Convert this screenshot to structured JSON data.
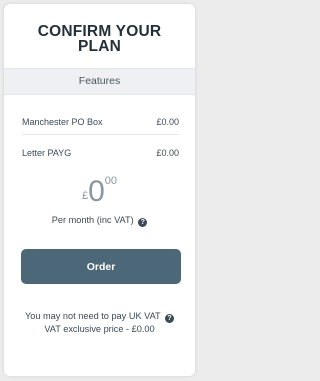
{
  "title": {
    "line1": "CONFIRM YOUR",
    "line2": "PLAN"
  },
  "features_header": "Features",
  "items": [
    {
      "label": "Manchester PO Box",
      "price": "£0.00"
    },
    {
      "label": "Letter PAYG",
      "price": "£0.00"
    }
  ],
  "price": {
    "currency": "£",
    "integer": "0",
    "decimal": "00"
  },
  "per_month_label": "Per month (inc VAT)",
  "help_icon_glyph": "?",
  "order_button": "Order",
  "vat_note": {
    "line1": "You may not need to pay UK VAT",
    "line2": "VAT exclusive price - £0.00"
  },
  "icons": {
    "help": "question-circle-icon"
  },
  "colors": {
    "button": "#4c6778",
    "title": "#243038"
  }
}
